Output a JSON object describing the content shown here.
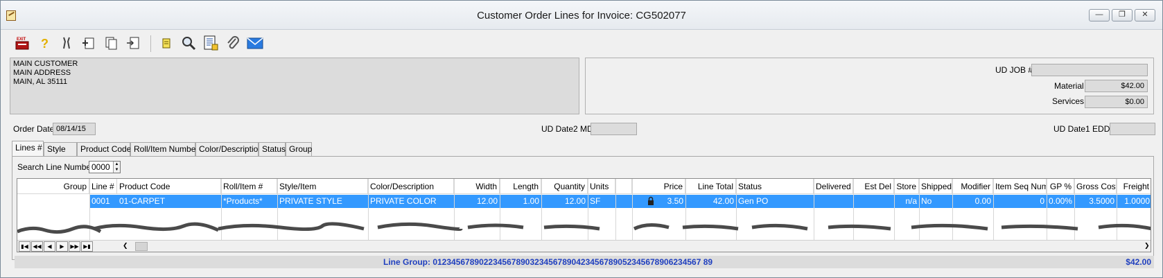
{
  "window": {
    "title": "Customer Order Lines for Invoice: CG502077"
  },
  "toolbar": {
    "buttons": [
      {
        "icon": "exit-icon",
        "label": "EXIT"
      },
      {
        "icon": "help-icon"
      },
      {
        "icon": "tools-icon"
      },
      {
        "icon": "new-document-icon"
      },
      {
        "icon": "copy-document-icon"
      },
      {
        "icon": "document-arrow-icon"
      },
      {
        "icon": "note-icon"
      },
      {
        "icon": "search-icon"
      },
      {
        "icon": "report-icon"
      },
      {
        "icon": "paperclip-icon"
      },
      {
        "icon": "email-icon"
      }
    ]
  },
  "customer": {
    "line1": "MAIN CUSTOMER",
    "line2": "MAIN ADDRESS",
    "line3": "MAIN, AL  35111"
  },
  "summary": {
    "ud_job_label": "UD JOB #",
    "ud_job_value": "",
    "material_label": "Material",
    "material_value": "$42.00",
    "services_label": "Services",
    "services_value": "$0.00"
  },
  "dates": {
    "order_date_label": "Order Date",
    "order_date_value": "08/14/15",
    "ud_date2_label": "UD Date2 MD",
    "ud_date2_value": "",
    "ud_date1_label": "UD Date1 EDD",
    "ud_date1_value": ""
  },
  "tabs": [
    "Lines #",
    "Style",
    "Product Code",
    "Roll/Item Number",
    "Color/Description",
    "Status",
    "Group"
  ],
  "search": {
    "label": "Search Line Number",
    "value": "0000"
  },
  "grid": {
    "columns": [
      "Group",
      "Line #",
      "Product Code",
      "Roll/Item #",
      "Style/Item",
      "Color/Description",
      "Width",
      "Length",
      "Quantity",
      "Units",
      "",
      "Price",
      "Line Total",
      "Status",
      "Delivered",
      "Est Del",
      "Store",
      "Shipped",
      "Modifier",
      "Item Seq Num",
      "GP %",
      "Gross Cost",
      "Freight"
    ],
    "rows": [
      [
        "",
        "0001",
        "01-CARPET",
        "*Products*",
        "PRIVATE STYLE",
        "PRIVATE COLOR",
        "12.00",
        "1.00",
        "12.00",
        "SF",
        "",
        "3.50",
        "42.00",
        "Gen PO",
        "",
        "",
        "n/a",
        "No",
        "0.00",
        "0",
        "0.00%",
        "3.5000",
        "1.0000"
      ]
    ]
  },
  "nav": [
    "first",
    "prev-page",
    "prev",
    "next",
    "next-page",
    "last"
  ],
  "footer": {
    "line_group": "Line Group: 0123456789022345678903234567890423456789052345678906234567 89",
    "total": "$42.00"
  }
}
